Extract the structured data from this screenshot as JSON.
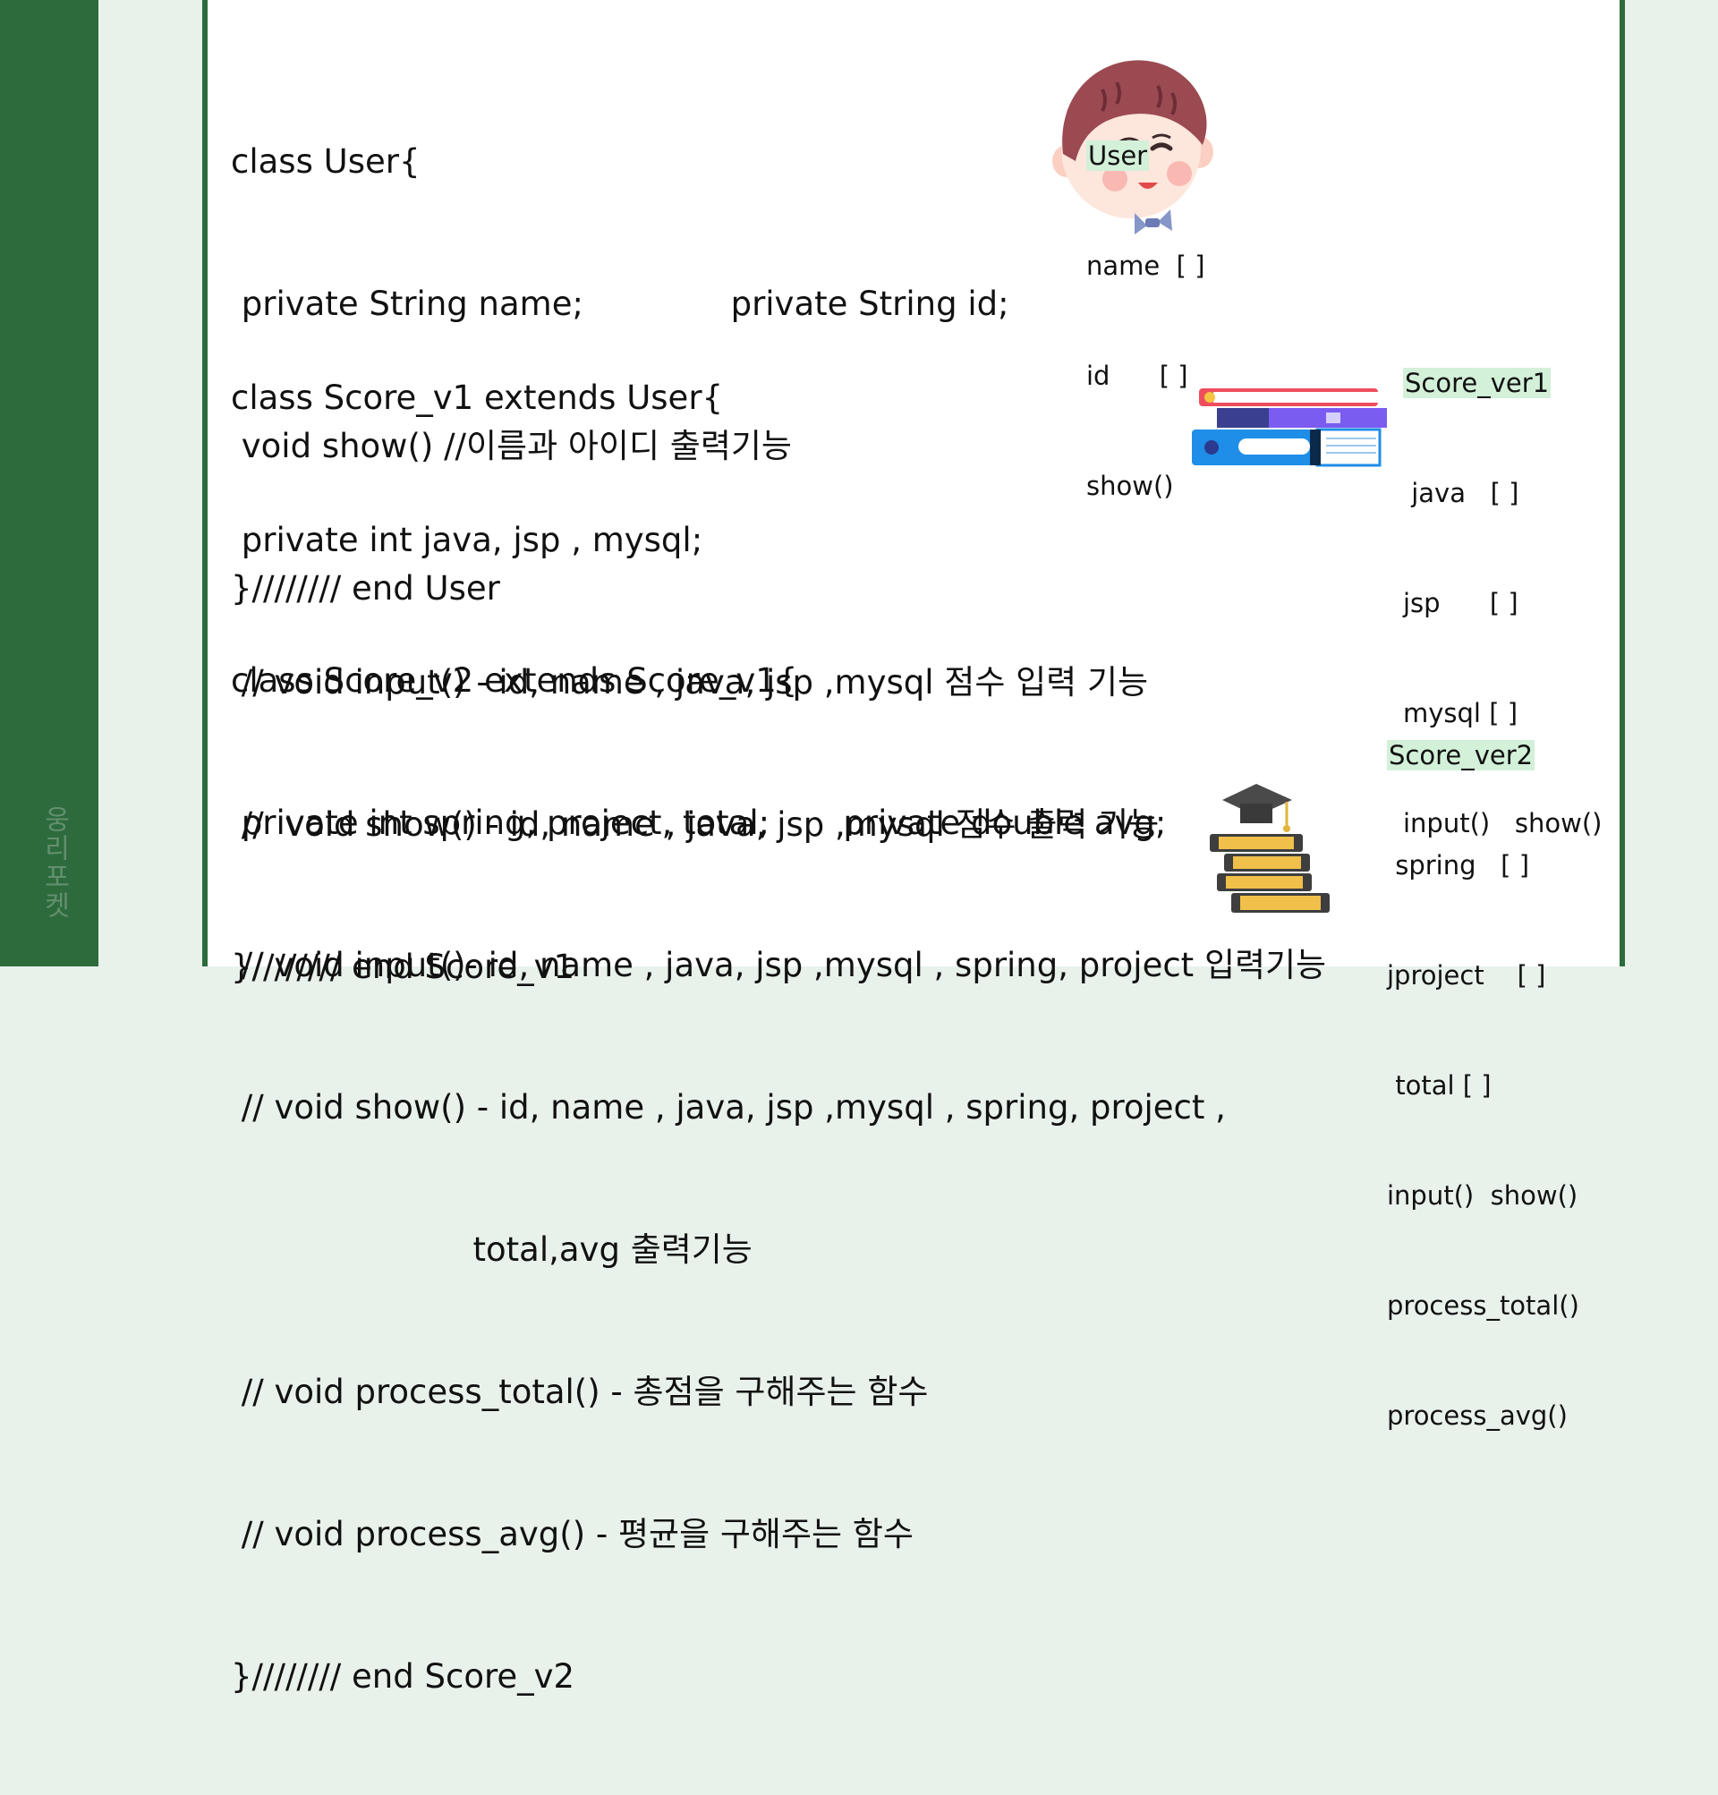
{
  "watermark": "웅리포켓",
  "sections": [
    {
      "lines": [
        "class User{",
        " private String name;              private String id;",
        " void show() //이름과 아이디 출력기능",
        "}//////// end User"
      ],
      "panel": {
        "title": "User",
        "items": [
          "name  [ ]",
          "id      [ ]",
          "show()"
        ]
      }
    },
    {
      "lines": [
        "class Score_v1 extends User{",
        " private int java, jsp , mysql;",
        " // void input() - id, name , java, jsp ,mysql 점수 입력 기능",
        " //  void show() - id, name , java, jsp ,mysql 점수 출력 기능",
        "}//////// end Score_v1"
      ],
      "panel": {
        "title": "Score_ver1",
        "items": [
          " java   [ ]",
          "jsp      [ ]",
          "mysql [ ]",
          "input()   show()"
        ]
      }
    },
    {
      "lines": [
        "class Score_v2 extends Score_v1{",
        " private int spring, project, total;       private double avg;",
        " // void input()- id, name , java, jsp ,mysql , spring, project 입력기능",
        " // void show() - id, name , java, jsp ,mysql , spring, project ,",
        "                       total,avg 출력기능",
        " // void process_total() - 총점을 구해주는 함수",
        " // void process_avg() - 평균을 구해주는 함수",
        "}//////// end Score_v2"
      ],
      "panel": {
        "title": "Score_ver2",
        "items": [
          " spring   [ ]",
          "jproject    [ ]",
          " total [ ]",
          "input()  show()",
          "process_total()",
          "process_avg()"
        ]
      }
    }
  ],
  "colors": {
    "accent_green": "#2d6b3c",
    "highlight": "#d3f0d9"
  },
  "icons": [
    "boy-face-icon",
    "books-stack-icon",
    "graduation-books-icon"
  ]
}
